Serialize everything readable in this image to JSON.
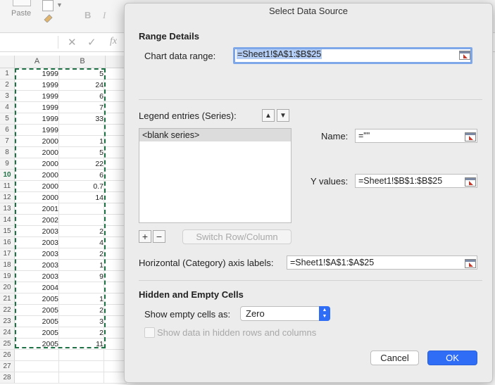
{
  "excel": {
    "ribbon": {
      "paste_label": "Paste",
      "bold_label": "B",
      "italic_label": "I"
    },
    "formula_bar": {
      "cancel_symbol": "✕",
      "enter_symbol": "✓",
      "fx_label": "fx"
    },
    "columns": [
      "A",
      "B"
    ],
    "active_row": 10,
    "rows": [
      {
        "n": "1",
        "a": "1999",
        "b": "5"
      },
      {
        "n": "2",
        "a": "1999",
        "b": "24"
      },
      {
        "n": "3",
        "a": "1999",
        "b": "6"
      },
      {
        "n": "4",
        "a": "1999",
        "b": "7"
      },
      {
        "n": "5",
        "a": "1999",
        "b": "33"
      },
      {
        "n": "6",
        "a": "1999",
        "b": ""
      },
      {
        "n": "7",
        "a": "2000",
        "b": "1"
      },
      {
        "n": "8",
        "a": "2000",
        "b": "5"
      },
      {
        "n": "9",
        "a": "2000",
        "b": "22"
      },
      {
        "n": "10",
        "a": "2000",
        "b": "6"
      },
      {
        "n": "11",
        "a": "2000",
        "b": "0.7"
      },
      {
        "n": "12",
        "a": "2000",
        "b": "14"
      },
      {
        "n": "13",
        "a": "2001",
        "b": ""
      },
      {
        "n": "14",
        "a": "2002",
        "b": ""
      },
      {
        "n": "15",
        "a": "2003",
        "b": "2"
      },
      {
        "n": "16",
        "a": "2003",
        "b": "4"
      },
      {
        "n": "17",
        "a": "2003",
        "b": "2"
      },
      {
        "n": "18",
        "a": "2003",
        "b": "1"
      },
      {
        "n": "19",
        "a": "2003",
        "b": "9"
      },
      {
        "n": "20",
        "a": "2004",
        "b": ""
      },
      {
        "n": "21",
        "a": "2005",
        "b": "1"
      },
      {
        "n": "22",
        "a": "2005",
        "b": "2"
      },
      {
        "n": "23",
        "a": "2005",
        "b": "3"
      },
      {
        "n": "24",
        "a": "2005",
        "b": "2"
      },
      {
        "n": "25",
        "a": "2005",
        "b": "11"
      },
      {
        "n": "26",
        "a": "",
        "b": ""
      },
      {
        "n": "27",
        "a": "",
        "b": ""
      },
      {
        "n": "28",
        "a": "",
        "b": ""
      }
    ]
  },
  "dialog": {
    "title": "Select Data Source",
    "range_details": {
      "heading": "Range Details",
      "chart_data_range_label": "Chart data range:",
      "chart_data_range_value": "=Sheet1!$A$1:$B$25"
    },
    "legend": {
      "label": "Legend entries (Series):",
      "up_arrow": "▲",
      "down_arrow": "▼",
      "series": [
        "<blank series>"
      ],
      "add_symbol": "+",
      "remove_symbol": "−",
      "switch_button": "Switch Row/Column"
    },
    "series_detail": {
      "name_label": "Name:",
      "name_value": "=\"\"",
      "y_values_label": "Y values:",
      "y_values_value": "=Sheet1!$B$1:$B$25"
    },
    "axis_labels": {
      "label": "Horizontal (Category) axis labels:",
      "value": "=Sheet1!$A$1:$A$25"
    },
    "hidden_empty": {
      "heading": "Hidden and Empty Cells",
      "show_empty_label": "Show empty cells as:",
      "show_empty_value": "Zero",
      "show_hidden_label": "Show data in hidden rows and columns"
    },
    "buttons": {
      "cancel": "Cancel",
      "ok": "OK"
    }
  }
}
